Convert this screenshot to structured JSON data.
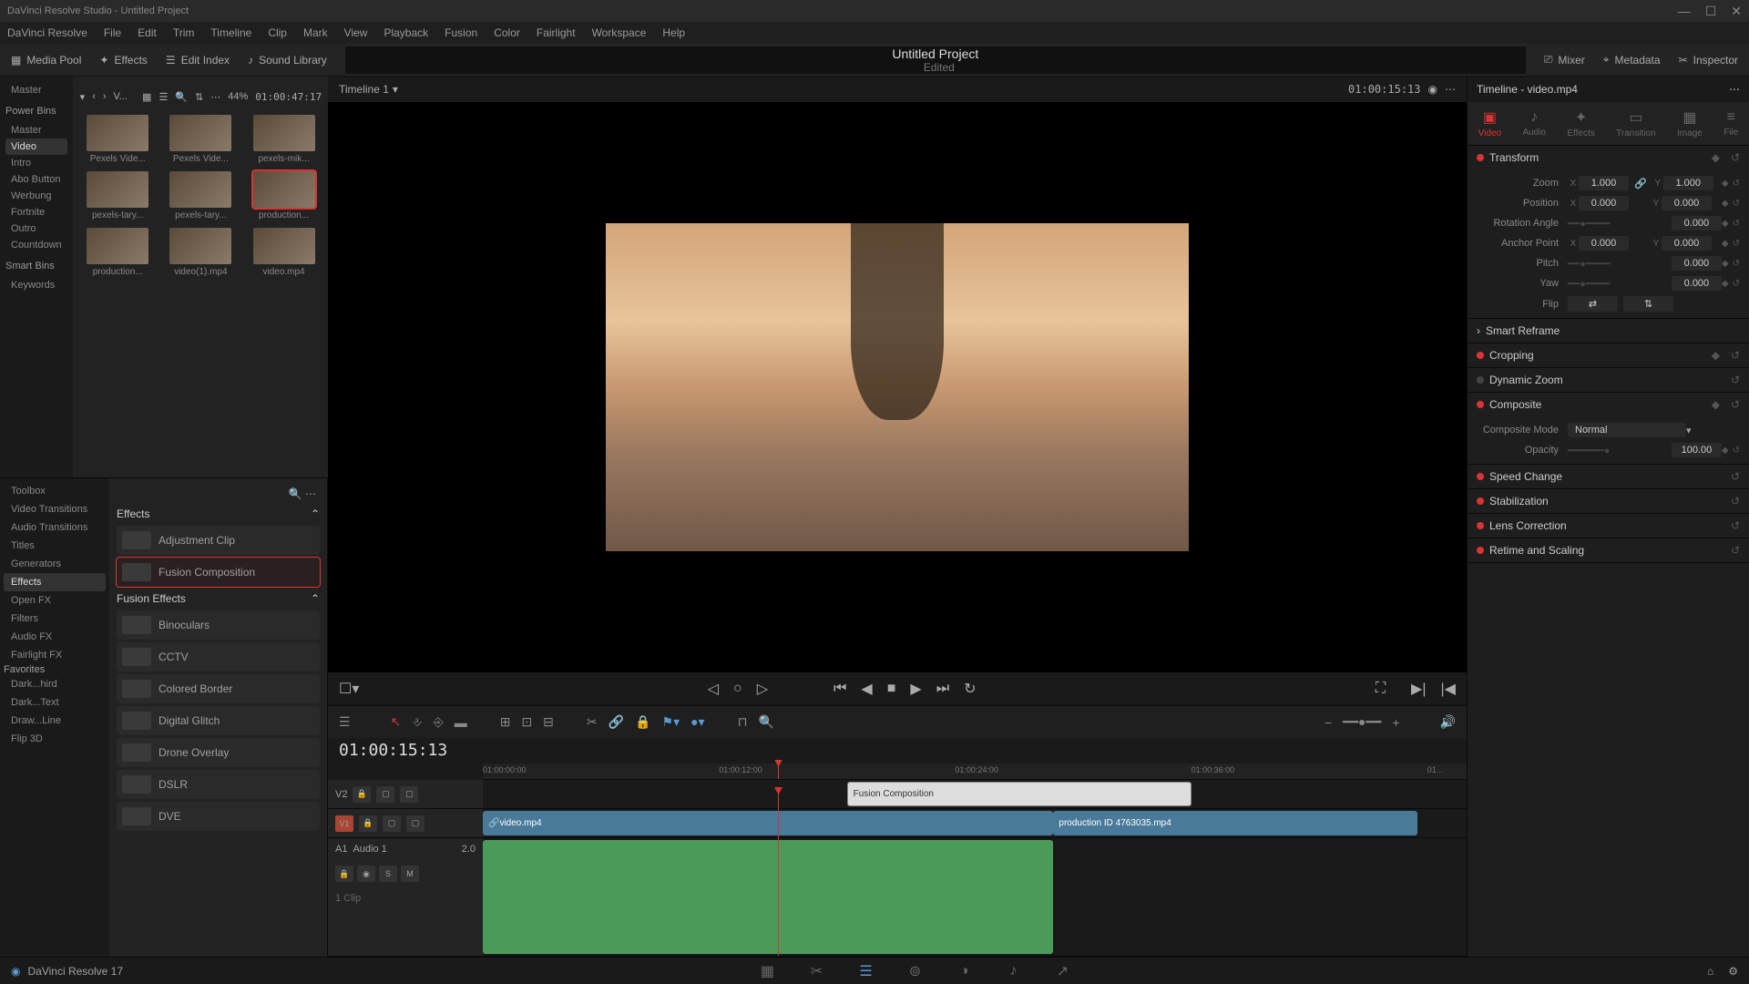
{
  "titlebar": {
    "title": "DaVinci Resolve Studio - Untitled Project"
  },
  "menubar": [
    "DaVinci Resolve",
    "File",
    "Edit",
    "Trim",
    "Timeline",
    "Clip",
    "Mark",
    "View",
    "Playback",
    "Fusion",
    "Color",
    "Fairlight",
    "Workspace",
    "Help"
  ],
  "toolbar": {
    "mediapool": "Media Pool",
    "effects": "Effects",
    "editindex": "Edit Index",
    "soundlib": "Sound Library",
    "project": "Untitled Project",
    "edited": "Edited",
    "mixer": "Mixer",
    "metadata": "Metadata",
    "inspector": "Inspector"
  },
  "mediagrid": {
    "zoom_pct": "44%",
    "timecode": "01:00:47:17",
    "sortlabel": "V...",
    "thumbs": [
      {
        "label": "Pexels Vide..."
      },
      {
        "label": "Pexels Vide..."
      },
      {
        "label": "pexels-mik..."
      },
      {
        "label": "pexels-tary..."
      },
      {
        "label": "pexels-tary..."
      },
      {
        "label": "production...",
        "selected": true
      },
      {
        "label": "production..."
      },
      {
        "label": "video(1).mp4"
      },
      {
        "label": "video.mp4"
      }
    ]
  },
  "bins": {
    "master": "Master",
    "powerbins": "Power Bins",
    "items": [
      "Master",
      "Video",
      "Intro",
      "Abo Button",
      "Werbung",
      "Fortnite",
      "Outro",
      "Countdown"
    ],
    "smartbins": "Smart Bins",
    "keywords": "Keywords"
  },
  "fx": {
    "side": [
      "Toolbox",
      "Video Transitions",
      "Audio Transitions",
      "Titles",
      "Generators",
      "Effects",
      "Open FX",
      "Filters",
      "Audio FX",
      "Fairlight FX"
    ],
    "favorites_header": "Favorites",
    "favorites": [
      "Dark...hird",
      "Dark...Text",
      "Draw...Line",
      "Flip 3D"
    ],
    "section1": "Effects",
    "list1": [
      {
        "name": "Adjustment Clip"
      },
      {
        "name": "Fusion Composition",
        "selected": true
      }
    ],
    "section2": "Fusion Effects",
    "list2": [
      {
        "name": "Binoculars"
      },
      {
        "name": "CCTV"
      },
      {
        "name": "Colored Border"
      },
      {
        "name": "Digital Glitch"
      },
      {
        "name": "Drone Overlay"
      },
      {
        "name": "DSLR"
      },
      {
        "name": "DVE"
      }
    ]
  },
  "viewer": {
    "timeline_name": "Timeline 1",
    "source_tc": "01:00:15:13"
  },
  "timeline": {
    "current_tc": "01:00:15:13",
    "ticks": [
      "01:00:00:00",
      "01:00:12:00",
      "01:00:24:00",
      "01:00:36:00",
      "01..."
    ],
    "v2": "V2",
    "v1": "V1",
    "a1": "A1",
    "a1_label": "Audio 1",
    "a1_ch": "2.0",
    "a1_clips": "1 Clip",
    "fusion_clip": "Fusion Composition",
    "video1": "video.mp4",
    "video2": "production ID 4763035.mp4"
  },
  "inspector": {
    "header": "Timeline - video.mp4",
    "tabs": [
      "Video",
      "Audio",
      "Effects",
      "Transition",
      "Image",
      "File"
    ],
    "transform": "Transform",
    "zoom": "Zoom",
    "zoom_x": "1.000",
    "zoom_y": "1.000",
    "position": "Position",
    "pos_x": "0.000",
    "pos_y": "0.000",
    "rotation": "Rotation Angle",
    "rot_v": "0.000",
    "anchor": "Anchor Point",
    "anc_x": "0.000",
    "anc_y": "0.000",
    "pitch": "Pitch",
    "pitch_v": "0.000",
    "yaw": "Yaw",
    "yaw_v": "0.000",
    "flip": "Flip",
    "smartreframe": "Smart Reframe",
    "cropping": "Cropping",
    "dynamiczoom": "Dynamic Zoom",
    "composite": "Composite",
    "comp_mode_lbl": "Composite Mode",
    "comp_mode": "Normal",
    "opacity_lbl": "Opacity",
    "opacity": "100.00",
    "speedchange": "Speed Change",
    "stabilization": "Stabilization",
    "lens": "Lens Correction",
    "retime": "Retime and Scaling"
  },
  "bottombar": {
    "brand": "DaVinci Resolve 17"
  }
}
